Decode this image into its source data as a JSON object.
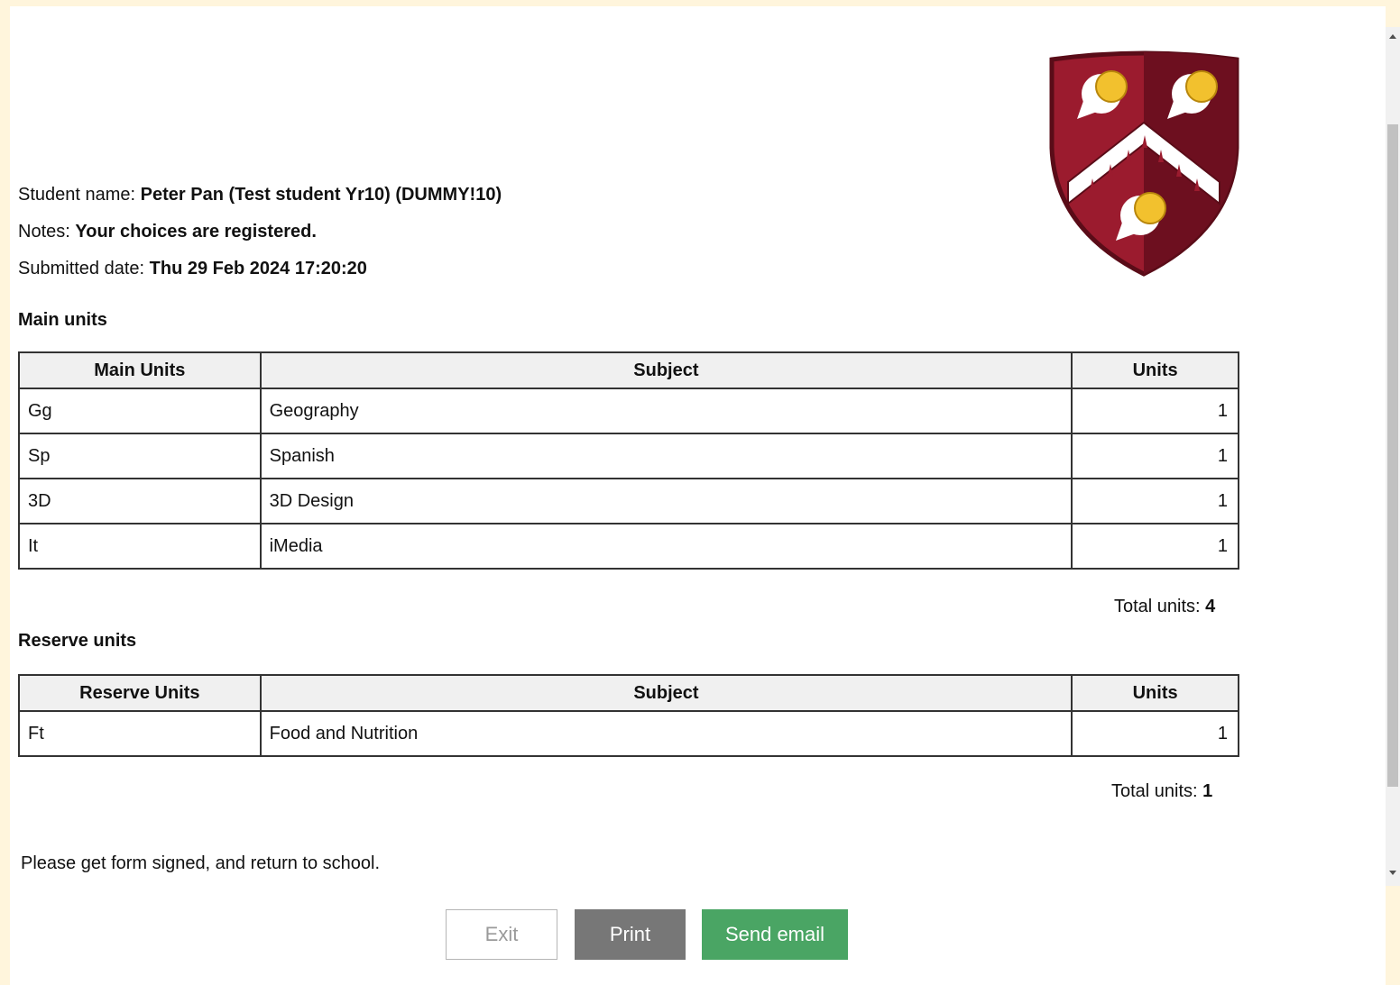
{
  "student": {
    "name_label": "Student name:",
    "name_value": "Peter Pan (Test student Yr10) (DUMMY!10)",
    "notes_label": "Notes:",
    "notes_value": "Your choices are registered.",
    "date_label": "Submitted date:",
    "date_value": "Thu 29 Feb 2024 17:20:20"
  },
  "main_units": {
    "title": "Main units",
    "headers": [
      "Main Units",
      "Subject",
      "Units"
    ],
    "rows": [
      {
        "code": "Gg",
        "subject": "Geography",
        "units": "1"
      },
      {
        "code": "Sp",
        "subject": "Spanish",
        "units": "1"
      },
      {
        "code": "3D",
        "subject": "3D Design",
        "units": "1"
      },
      {
        "code": "It",
        "subject": "iMedia",
        "units": "1"
      }
    ],
    "total_label": "Total units:",
    "total_value": "4"
  },
  "reserve_units": {
    "title": "Reserve units",
    "headers": [
      "Reserve Units",
      "Subject",
      "Units"
    ],
    "rows": [
      {
        "code": "Ft",
        "subject": "Food and Nutrition",
        "units": "1"
      }
    ],
    "total_label": "Total units:",
    "total_value": "1"
  },
  "footer_note": "Please get form signed, and return to school.",
  "buttons": {
    "exit": "Exit",
    "print": "Print",
    "send_email": "Send email"
  },
  "colors": {
    "page_border": "#fff5dc",
    "crest_red": "#9b1b2e",
    "crest_dark": "#6d0f1f",
    "print_button": "#777777",
    "email_button": "#4aa564"
  },
  "icons": {
    "crest": "school-crest-icon"
  }
}
